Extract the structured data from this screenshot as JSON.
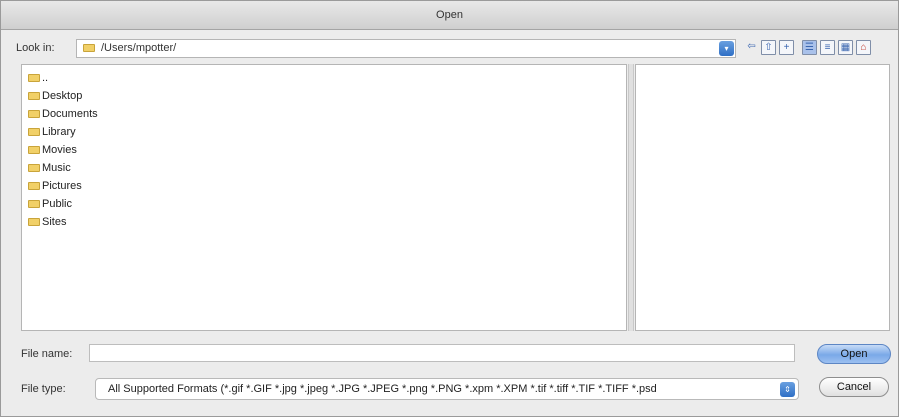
{
  "window": {
    "title": "Open"
  },
  "lookin": {
    "label": "Look in:",
    "path": "/Users/mpotter/",
    "arrow_glyph": "▾"
  },
  "toolbar": {
    "icons": [
      "back-arrow-icon",
      "up-folder-icon",
      "new-folder-icon",
      "detail-view-icon",
      "list-view-icon",
      "preview-view-icon",
      "home-icon"
    ]
  },
  "files": [
    {
      "label": ".."
    },
    {
      "label": "Desktop"
    },
    {
      "label": "Documents"
    },
    {
      "label": "Library"
    },
    {
      "label": "Movies"
    },
    {
      "label": "Music"
    },
    {
      "label": "Pictures"
    },
    {
      "label": "Public"
    },
    {
      "label": "Sites"
    }
  ],
  "filename": {
    "label": "File name:",
    "value": ""
  },
  "filetype": {
    "label": "File type:",
    "selected": "All Supported Formats (*.gif *.GIF *.jpg *.jpeg *.JPG *.JPEG *.png *.PNG *.xpm *.XPM *.tif *.tiff *.TIF *.TIFF *.psd"
  },
  "buttons": {
    "open": "Open",
    "cancel": "Cancel"
  },
  "colors": {
    "accent": "#2f6fc5",
    "folder": "#f1d068"
  }
}
